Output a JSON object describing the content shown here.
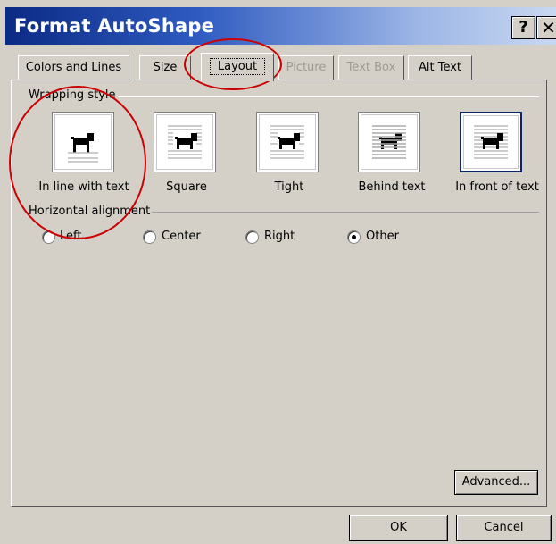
{
  "window": {
    "title": "Format AutoShape",
    "help_glyph": "?",
    "close_glyph": "✕"
  },
  "tabs": [
    {
      "label": "Colors and Lines",
      "state": "normal"
    },
    {
      "label": "Size",
      "state": "normal"
    },
    {
      "label": "Layout",
      "state": "active"
    },
    {
      "label": "Picture",
      "state": "disabled"
    },
    {
      "label": "Text Box",
      "state": "disabled"
    },
    {
      "label": "Alt Text",
      "state": "normal"
    }
  ],
  "wrapping": {
    "group_label": "Wrapping style",
    "options": [
      {
        "label": "In line with text",
        "icon": "inline-wrap-icon",
        "selected": false
      },
      {
        "label": "Square",
        "icon": "square-wrap-icon",
        "selected": false
      },
      {
        "label": "Tight",
        "icon": "tight-wrap-icon",
        "selected": false
      },
      {
        "label": "Behind text",
        "icon": "behind-text-icon",
        "selected": false
      },
      {
        "label": "In front of text",
        "icon": "in-front-of-text-icon",
        "selected": true
      }
    ]
  },
  "alignment": {
    "group_label": "Horizontal alignment",
    "options": [
      {
        "label": "Left",
        "checked": false
      },
      {
        "label": "Center",
        "checked": false
      },
      {
        "label": "Right",
        "checked": false
      },
      {
        "label": "Other",
        "checked": true
      }
    ]
  },
  "buttons": {
    "advanced": "Advanced...",
    "ok": "OK",
    "cancel": "Cancel"
  },
  "colors": {
    "title_gradient_start": "#0b2a84",
    "dialog_bg": "#d4d0c8",
    "annotation": "#cc0000",
    "selection_border": "#0a246a"
  }
}
